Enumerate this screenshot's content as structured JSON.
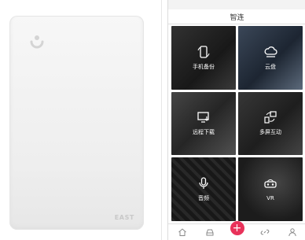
{
  "left": {
    "device_brand": "EAST"
  },
  "phone": {
    "status_time": "",
    "status_right": "",
    "title": "智连",
    "tiles": [
      {
        "label": "手机备份",
        "icon": "phone-backup-icon"
      },
      {
        "label": "云盘",
        "icon": "cloud-drive-icon"
      },
      {
        "label": "远程下载",
        "icon": "remote-download-icon"
      },
      {
        "label": "多屏互动",
        "icon": "multiscreen-icon"
      },
      {
        "label": "音频",
        "icon": "microphone-icon"
      },
      {
        "label": "VR",
        "icon": "vr-headset-icon"
      }
    ],
    "bottom_nav": [
      {
        "name": "home",
        "icon": "home-icon"
      },
      {
        "name": "device",
        "icon": "drive-icon"
      },
      {
        "name": "add",
        "icon": "plus-icon"
      },
      {
        "name": "link",
        "icon": "link-icon"
      },
      {
        "name": "user",
        "icon": "user-icon"
      }
    ],
    "accent_color": "#e8325a"
  }
}
